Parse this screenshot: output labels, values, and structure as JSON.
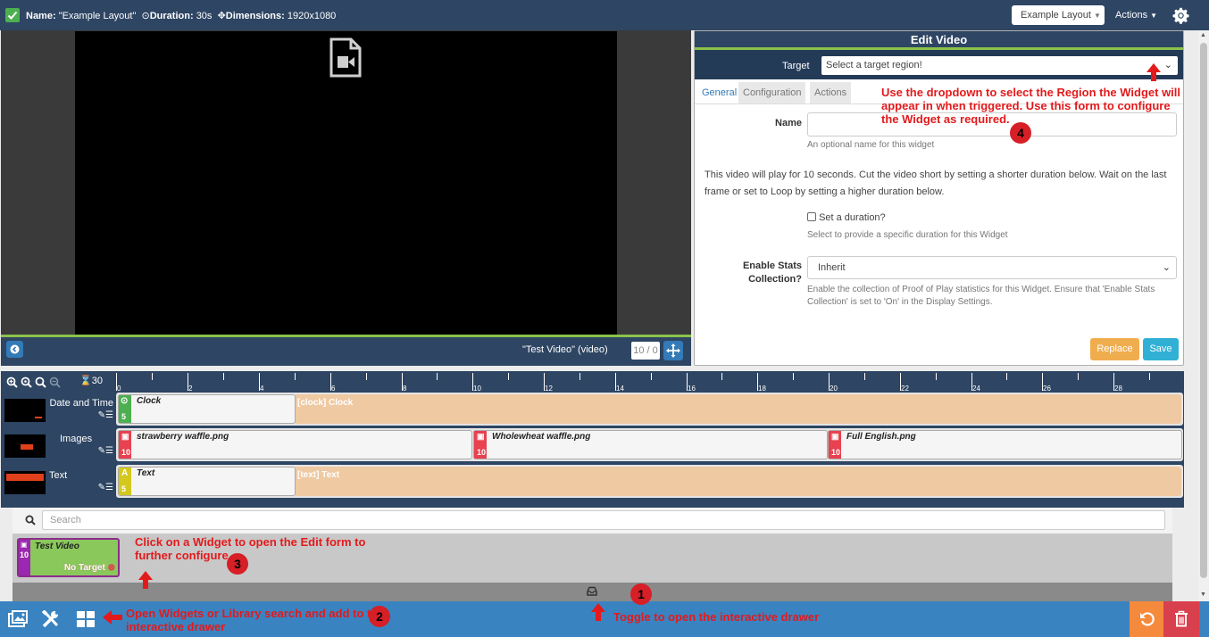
{
  "topbar": {
    "name_label": "Name:",
    "name_value": "\"Example Layout\"",
    "duration_label": "Duration:",
    "duration_value": "30s",
    "dimensions_label": "Dimensions:",
    "dimensions_value": "1920x1080",
    "layout_dropdown": "Example Layout",
    "actions_dropdown": "Actions"
  },
  "viewer": {
    "label": "\"Test Video\" (video)",
    "counter": "10 / 0"
  },
  "edit": {
    "title": "Edit Video",
    "target_label": "Target",
    "target_placeholder": "Select a target region!",
    "tabs": [
      "General",
      "Configuration",
      "Actions"
    ],
    "name_label": "Name",
    "name_value": "",
    "name_help": "An optional name for this widget",
    "description": "This video will play for 10 seconds. Cut the video short by setting a shorter duration below. Wait on the last frame or set to Loop by setting a higher duration below.",
    "duration_checkbox": "Set a duration?",
    "duration_help": "Select to provide a specific duration for this Widget",
    "stats_label_1": "Enable Stats",
    "stats_label_2": "Collection?",
    "stats_value": "Inherit",
    "stats_help": "Enable the collection of Proof of Play statistics for this Widget. Ensure that 'Enable Stats Collection' is set to 'On' in the Display Settings.",
    "replace_button": "Replace",
    "save_button": "Save"
  },
  "timeline": {
    "duration": "30",
    "ticks": [
      "0",
      "2",
      "4",
      "6",
      "8",
      "10",
      "12",
      "14",
      "16",
      "18",
      "20",
      "22",
      "24",
      "26",
      "28"
    ],
    "lanes": [
      {
        "name": "Date and Time",
        "widgets": [
          {
            "name": "Clock",
            "duration": "5",
            "extension": "[clock] Clock"
          }
        ]
      },
      {
        "name": "Images",
        "widgets": [
          {
            "name": "strawberry waffle.png",
            "duration": "10"
          },
          {
            "name": "Wholewheat waffle.png",
            "duration": "10"
          },
          {
            "name": "Full English.png",
            "duration": "10"
          }
        ]
      },
      {
        "name": "Text",
        "widgets": [
          {
            "name": "Text",
            "duration": "5",
            "extension": "[text] Text",
            "badge_letter": "A"
          }
        ]
      }
    ]
  },
  "toolbox": {
    "search_placeholder": "Search",
    "widget_card": {
      "name": "Test Video",
      "duration": "10",
      "status": "No Target"
    }
  },
  "annotations": [
    {
      "number": "1",
      "text": "Toggle to open the interactive drawer"
    },
    {
      "number": "2",
      "text_1": "Open Widgets or Library search and add to the",
      "text_2": "interactive drawer"
    },
    {
      "number": "3",
      "text_1": "Click on a Widget to open the Edit form to",
      "text_2": "further configure"
    },
    {
      "number": "4",
      "text_1": "Use the dropdown to select the Region the Widget will",
      "text_2": "appear in when triggered. Use this form to configure",
      "text_3": "the Widget as required."
    }
  ],
  "colors": {
    "navbar": "#2e4563",
    "accent_green": "#8bc34a",
    "primary": "#337ab7",
    "warning": "#f0ad4e",
    "info": "#31b0d5",
    "image_widget": "#e8414f",
    "clock_widget": "#4caf50",
    "text_widget": "#d4c81f",
    "video_widget": "#9c27b0",
    "annotation": "#e31a1c",
    "bottom_bar": "#3a83c1",
    "undo": "#f58a3c",
    "delete": "#d9404e"
  },
  "icons": [
    "check-icon",
    "clock-icon",
    "arrows-icon",
    "gear-icon",
    "video-file-icon",
    "circle-arrow-icon",
    "zoom-in-icon",
    "zoom-out-icon",
    "hourglass-icon",
    "edit-icon",
    "list-icon",
    "image-icon",
    "text-icon",
    "search-icon",
    "drawer-icon",
    "library-icon",
    "tools-icon",
    "widgets-icon",
    "undo-icon",
    "trash-icon",
    "arrow-up-icon",
    "arrow-left-icon"
  ]
}
